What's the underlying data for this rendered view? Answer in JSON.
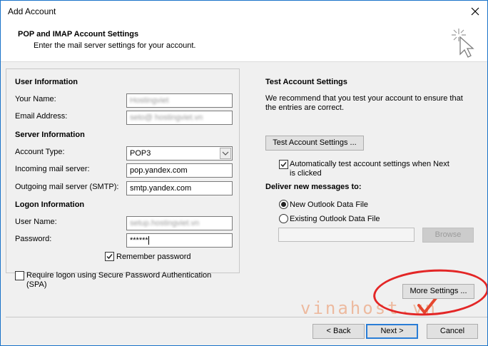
{
  "window": {
    "title": "Add Account"
  },
  "header": {
    "title": "POP and IMAP Account Settings",
    "subtitle": "Enter the mail server settings for your account."
  },
  "user_info": {
    "heading": "User Information",
    "name_label": "Your Name:",
    "name_value": "Hostingviet",
    "email_label": "Email Address:",
    "email_value": "seto@ hostingviet.vn"
  },
  "server_info": {
    "heading": "Server Information",
    "account_type_label": "Account Type:",
    "account_type_value": "POP3",
    "incoming_label": "Incoming mail server:",
    "incoming_value": "pop.yandex.com",
    "outgoing_label": "Outgoing mail server (SMTP):",
    "outgoing_value": "smtp.yandex.com"
  },
  "logon_info": {
    "heading": "Logon Information",
    "username_label": "User Name:",
    "username_value": "setup.hostingviet.vn",
    "password_label": "Password:",
    "password_value": "******",
    "remember_label": "Remember password",
    "remember_checked": true,
    "spa_label_line1": "Require logon using Secure Password Authentication",
    "spa_label_line2": "(SPA)",
    "spa_checked": false
  },
  "test_settings": {
    "heading": "Test Account Settings",
    "description_line1": "We recommend that you test your account to ensure that",
    "description_line2": "the entries are correct.",
    "test_button": "Test Account Settings ...",
    "auto_test_line1": "Automatically test account settings when Next",
    "auto_test_line2": "is clicked",
    "auto_test_checked": true
  },
  "deliver": {
    "heading": "Deliver new messages to:",
    "option_new": "New Outlook Data File",
    "option_existing": "Existing Outlook Data File",
    "selected": "New Outlook Data File",
    "file_path_value": "",
    "browse_button": "Browse"
  },
  "buttons": {
    "more_settings": "More Settings ...",
    "back": "< Back",
    "next": "Next >",
    "cancel": "Cancel"
  },
  "watermark": {
    "text": "vinahost.vn"
  },
  "colors": {
    "accent": "#2a7dd6",
    "highlight_oval": "#e32626",
    "watermark": "#e8783c"
  },
  "icons": {
    "close": "close-icon",
    "wizard": "cursor-sparkle-icon",
    "dropdown": "chevron-down-icon",
    "check": "checkmark-icon"
  }
}
